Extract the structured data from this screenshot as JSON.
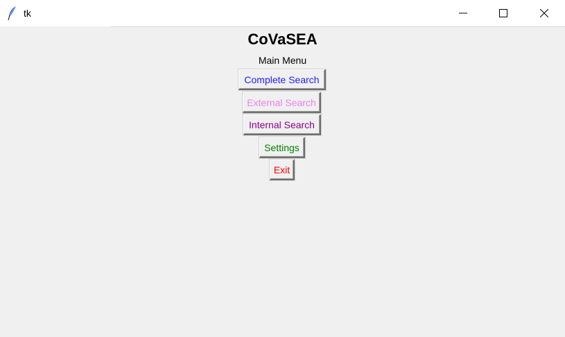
{
  "window": {
    "title": "tk",
    "icon": "feather-icon",
    "controls": [
      "minimize-icon",
      "maximize-icon",
      "close-icon"
    ]
  },
  "app": {
    "heading": "CoVaSEA",
    "subheading": "Main Menu"
  },
  "menu": {
    "buttons": [
      {
        "label": "Complete Search",
        "color": "#1f1fff"
      },
      {
        "label": "External Search",
        "color": "#ee82ee"
      },
      {
        "label": "Internal Search",
        "color": "#8b008b"
      },
      {
        "label": "Settings",
        "color": "#008000"
      },
      {
        "label": "Exit",
        "color": "#ff0000"
      }
    ]
  }
}
